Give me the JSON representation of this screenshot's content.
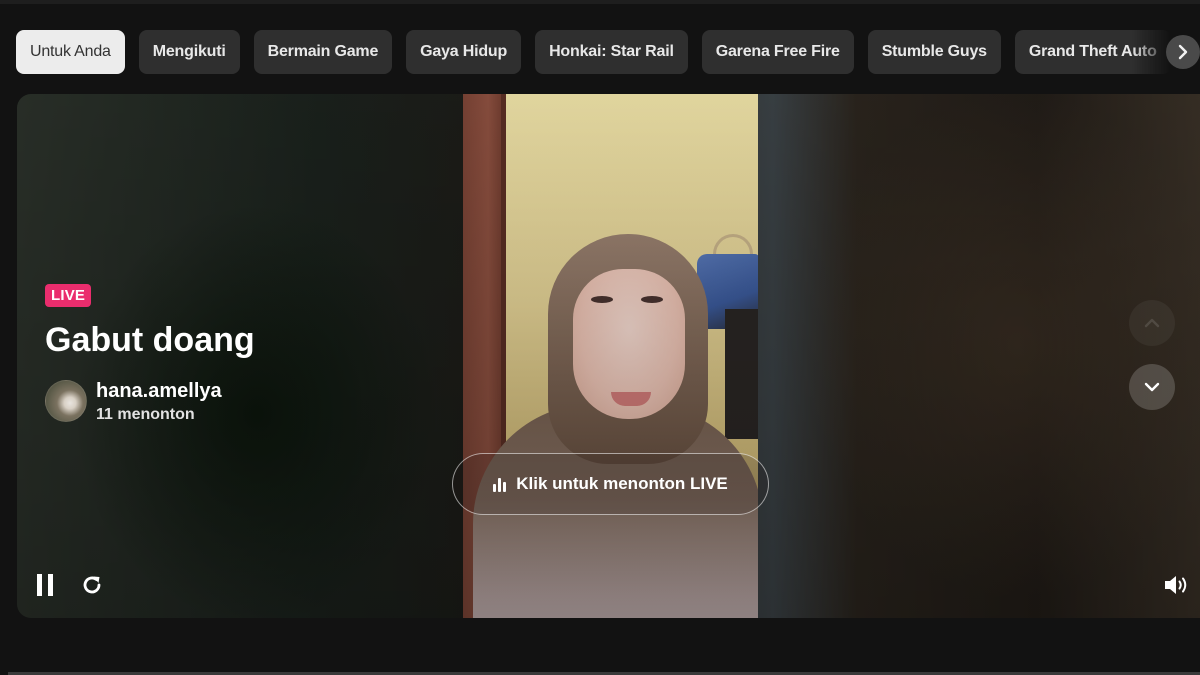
{
  "categories": {
    "items": [
      {
        "label": "Untuk Anda",
        "active": true
      },
      {
        "label": "Mengikuti",
        "active": false
      },
      {
        "label": "Bermain Game",
        "active": false
      },
      {
        "label": "Gaya Hidup",
        "active": false
      },
      {
        "label": "Honkai: Star Rail",
        "active": false
      },
      {
        "label": "Garena Free Fire",
        "active": false
      },
      {
        "label": "Stumble Guys",
        "active": false
      },
      {
        "label": "Grand Theft Auto",
        "active": false
      }
    ],
    "next_icon": "chevron-right-icon"
  },
  "stream": {
    "live_badge": "LIVE",
    "title": "Gabut doang",
    "username": "hana.amellya",
    "viewers": "11 menonton",
    "cta_label": "Klik untuk menonton LIVE",
    "cta_icon": "bar-chart-icon"
  },
  "controls": {
    "pause_icon": "pause-icon",
    "replay_icon": "replay-icon",
    "volume_icon": "volume-icon",
    "nav_up_icon": "chevron-up-icon",
    "nav_down_icon": "chevron-down-icon"
  },
  "colors": {
    "live_badge": "#ea2d6d",
    "chip_bg": "#2f2f2f",
    "chip_active_bg": "#ececec",
    "page_bg": "#121212"
  }
}
